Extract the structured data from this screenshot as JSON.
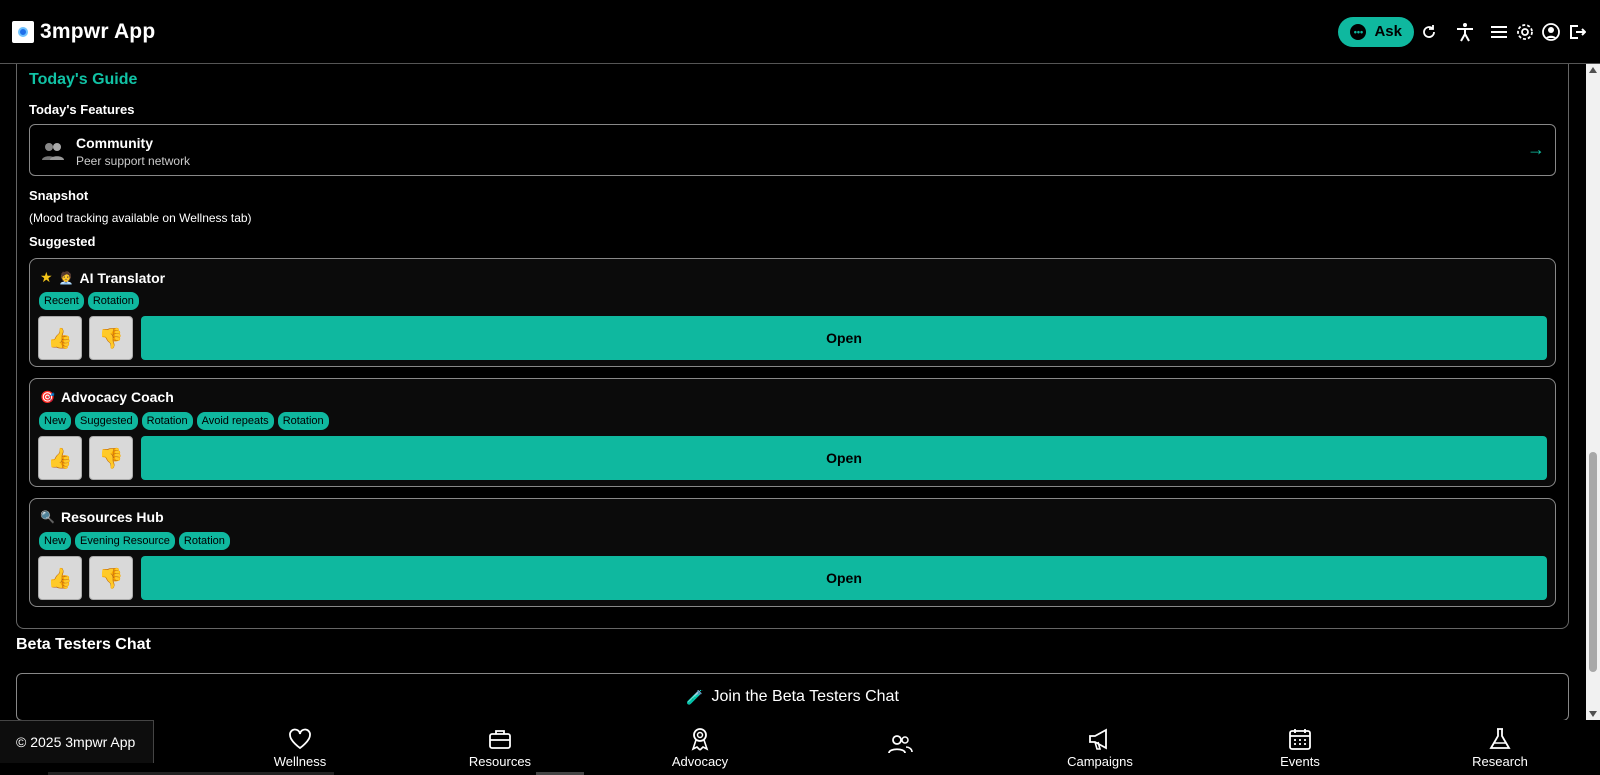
{
  "header": {
    "app_title": "3mpwr App",
    "ask_label": "Ask"
  },
  "guide": {
    "title": "Today's Guide",
    "features_label": "Today's Features",
    "feature": {
      "name": "Community",
      "description": "Peer support network",
      "arrow": "→"
    },
    "snapshot_label": "Snapshot",
    "snapshot_note": "(Mood tracking available on Wellness tab)",
    "suggested_label": "Suggested",
    "suggestions": [
      {
        "star": "★",
        "emoji": "🧑‍💼",
        "name": "AI Translator",
        "tags": [
          "Recent",
          "Rotation"
        ],
        "open_label": "Open"
      },
      {
        "emoji": "🎯",
        "name": "Advocacy Coach",
        "tags": [
          "New",
          "Suggested",
          "Rotation",
          "Avoid repeats",
          "Rotation"
        ],
        "open_label": "Open"
      },
      {
        "emoji": "🔍",
        "name": "Resources Hub",
        "tags": [
          "New",
          "Evening Resource",
          "Rotation"
        ],
        "open_label": "Open"
      }
    ],
    "thumbs_up": "👍",
    "thumbs_down": "👎"
  },
  "beta": {
    "title": "Beta Testers Chat",
    "emoji": "🧪",
    "button_label": "Join the Beta Testers Chat"
  },
  "footer": {
    "copyright": "© 2025 3mpwr App",
    "nav": [
      "Wellness",
      "Resources",
      "Advocacy",
      "",
      "Campaigns",
      "Events",
      "Research"
    ]
  },
  "colors": {
    "accent": "#0fb89f",
    "title_accent": "#11c2a5",
    "background": "#000000"
  }
}
